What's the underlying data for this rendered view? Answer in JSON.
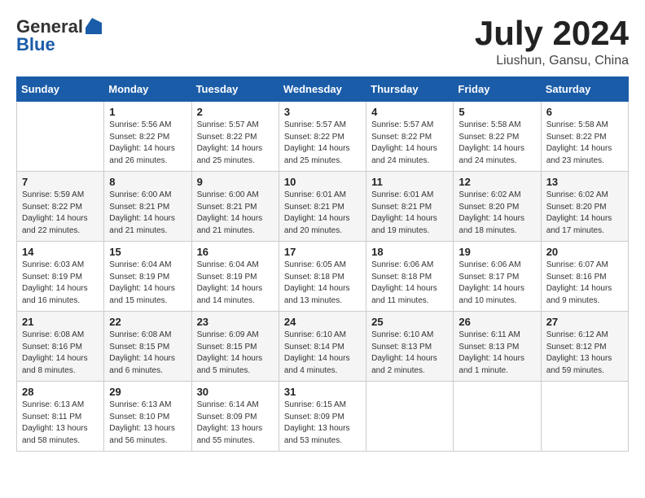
{
  "logo": {
    "general": "General",
    "blue": "Blue"
  },
  "title": "July 2024",
  "location": "Liushun, Gansu, China",
  "weekdays": [
    "Sunday",
    "Monday",
    "Tuesday",
    "Wednesday",
    "Thursday",
    "Friday",
    "Saturday"
  ],
  "weeks": [
    [
      {
        "day": "",
        "info": ""
      },
      {
        "day": "1",
        "info": "Sunrise: 5:56 AM\nSunset: 8:22 PM\nDaylight: 14 hours\nand 26 minutes."
      },
      {
        "day": "2",
        "info": "Sunrise: 5:57 AM\nSunset: 8:22 PM\nDaylight: 14 hours\nand 25 minutes."
      },
      {
        "day": "3",
        "info": "Sunrise: 5:57 AM\nSunset: 8:22 PM\nDaylight: 14 hours\nand 25 minutes."
      },
      {
        "day": "4",
        "info": "Sunrise: 5:57 AM\nSunset: 8:22 PM\nDaylight: 14 hours\nand 24 minutes."
      },
      {
        "day": "5",
        "info": "Sunrise: 5:58 AM\nSunset: 8:22 PM\nDaylight: 14 hours\nand 24 minutes."
      },
      {
        "day": "6",
        "info": "Sunrise: 5:58 AM\nSunset: 8:22 PM\nDaylight: 14 hours\nand 23 minutes."
      }
    ],
    [
      {
        "day": "7",
        "info": "Sunrise: 5:59 AM\nSunset: 8:22 PM\nDaylight: 14 hours\nand 22 minutes."
      },
      {
        "day": "8",
        "info": "Sunrise: 6:00 AM\nSunset: 8:21 PM\nDaylight: 14 hours\nand 21 minutes."
      },
      {
        "day": "9",
        "info": "Sunrise: 6:00 AM\nSunset: 8:21 PM\nDaylight: 14 hours\nand 21 minutes."
      },
      {
        "day": "10",
        "info": "Sunrise: 6:01 AM\nSunset: 8:21 PM\nDaylight: 14 hours\nand 20 minutes."
      },
      {
        "day": "11",
        "info": "Sunrise: 6:01 AM\nSunset: 8:21 PM\nDaylight: 14 hours\nand 19 minutes."
      },
      {
        "day": "12",
        "info": "Sunrise: 6:02 AM\nSunset: 8:20 PM\nDaylight: 14 hours\nand 18 minutes."
      },
      {
        "day": "13",
        "info": "Sunrise: 6:02 AM\nSunset: 8:20 PM\nDaylight: 14 hours\nand 17 minutes."
      }
    ],
    [
      {
        "day": "14",
        "info": "Sunrise: 6:03 AM\nSunset: 8:19 PM\nDaylight: 14 hours\nand 16 minutes."
      },
      {
        "day": "15",
        "info": "Sunrise: 6:04 AM\nSunset: 8:19 PM\nDaylight: 14 hours\nand 15 minutes."
      },
      {
        "day": "16",
        "info": "Sunrise: 6:04 AM\nSunset: 8:19 PM\nDaylight: 14 hours\nand 14 minutes."
      },
      {
        "day": "17",
        "info": "Sunrise: 6:05 AM\nSunset: 8:18 PM\nDaylight: 14 hours\nand 13 minutes."
      },
      {
        "day": "18",
        "info": "Sunrise: 6:06 AM\nSunset: 8:18 PM\nDaylight: 14 hours\nand 11 minutes."
      },
      {
        "day": "19",
        "info": "Sunrise: 6:06 AM\nSunset: 8:17 PM\nDaylight: 14 hours\nand 10 minutes."
      },
      {
        "day": "20",
        "info": "Sunrise: 6:07 AM\nSunset: 8:16 PM\nDaylight: 14 hours\nand 9 minutes."
      }
    ],
    [
      {
        "day": "21",
        "info": "Sunrise: 6:08 AM\nSunset: 8:16 PM\nDaylight: 14 hours\nand 8 minutes."
      },
      {
        "day": "22",
        "info": "Sunrise: 6:08 AM\nSunset: 8:15 PM\nDaylight: 14 hours\nand 6 minutes."
      },
      {
        "day": "23",
        "info": "Sunrise: 6:09 AM\nSunset: 8:15 PM\nDaylight: 14 hours\nand 5 minutes."
      },
      {
        "day": "24",
        "info": "Sunrise: 6:10 AM\nSunset: 8:14 PM\nDaylight: 14 hours\nand 4 minutes."
      },
      {
        "day": "25",
        "info": "Sunrise: 6:10 AM\nSunset: 8:13 PM\nDaylight: 14 hours\nand 2 minutes."
      },
      {
        "day": "26",
        "info": "Sunrise: 6:11 AM\nSunset: 8:13 PM\nDaylight: 14 hours\nand 1 minute."
      },
      {
        "day": "27",
        "info": "Sunrise: 6:12 AM\nSunset: 8:12 PM\nDaylight: 13 hours\nand 59 minutes."
      }
    ],
    [
      {
        "day": "28",
        "info": "Sunrise: 6:13 AM\nSunset: 8:11 PM\nDaylight: 13 hours\nand 58 minutes."
      },
      {
        "day": "29",
        "info": "Sunrise: 6:13 AM\nSunset: 8:10 PM\nDaylight: 13 hours\nand 56 minutes."
      },
      {
        "day": "30",
        "info": "Sunrise: 6:14 AM\nSunset: 8:09 PM\nDaylight: 13 hours\nand 55 minutes."
      },
      {
        "day": "31",
        "info": "Sunrise: 6:15 AM\nSunset: 8:09 PM\nDaylight: 13 hours\nand 53 minutes."
      },
      {
        "day": "",
        "info": ""
      },
      {
        "day": "",
        "info": ""
      },
      {
        "day": "",
        "info": ""
      }
    ]
  ]
}
